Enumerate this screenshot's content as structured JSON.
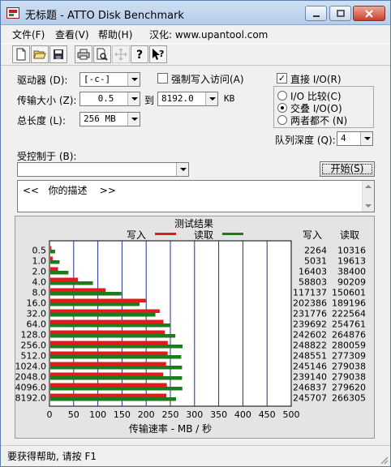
{
  "window": {
    "title": "无标题 - ATTO Disk Benchmark"
  },
  "menu": {
    "file": "文件(F)",
    "view": "查看(V)",
    "help": "帮助(H)",
    "credit": "汉化: www.upantool.com"
  },
  "toolbar": {
    "icons": [
      "new-file-icon",
      "open-folder-icon",
      "save-icon",
      "print-icon",
      "print-preview-icon",
      "move-icon",
      "help-icon",
      "context-help-icon"
    ]
  },
  "settings": {
    "drive_label": "驱动器 (D):",
    "drive_value": "[-c-]",
    "transfer_label": "传输大小 (Z):",
    "transfer_from": "0.5",
    "to_label": "到",
    "transfer_to": "8192.0",
    "kb_unit": "KB",
    "total_label": "总长度 (L):",
    "total_value": "256 MB",
    "force_write_label": "强制写入访问(A)",
    "force_write_checked": false,
    "direct_io_label": "直接 I/O(R)",
    "direct_io_checked": true,
    "io_compare_label": "I/O 比较(C)",
    "overlap_io_label": "交叠 I/O(O)",
    "neither_label": "两者都不 (N)",
    "selected_io_mode": "overlap",
    "queue_depth_label": "队列深度 (Q):",
    "queue_depth_value": "4",
    "controlled_by_label": "受控制于 (B):",
    "controlled_by_value": "",
    "start_button": "开始(S)",
    "description": "<<   你的描述    >>"
  },
  "chart_data": {
    "type": "bar",
    "title": "测试结果",
    "orientation": "horizontal",
    "legend": [
      {
        "name": "写入",
        "color": "#e01b1b"
      },
      {
        "name": "读取",
        "color": "#1d7a1d"
      }
    ],
    "legend_placement": "top",
    "categories": [
      "0.5",
      "1.0",
      "2.0",
      "4.0",
      "8.0",
      "16.0",
      "32.0",
      "64.0",
      "128.0",
      "256.0",
      "512.0",
      "1024.0",
      "2048.0",
      "4096.0",
      "8192.0"
    ],
    "series": [
      {
        "name": "写入",
        "color": "#e01b1b",
        "values": [
          2264,
          5031,
          16403,
          58803,
          117137,
          202386,
          231776,
          239692,
          242602,
          248822,
          248551,
          245146,
          239140,
          246837,
          245707
        ]
      },
      {
        "name": "读取",
        "color": "#1d7a1d",
        "values": [
          10316,
          19613,
          38400,
          90209,
          150601,
          189196,
          222564,
          254761,
          264876,
          280059,
          277309,
          279038,
          279038,
          279620,
          266305
        ]
      }
    ],
    "xlabel": "传输速率 - MB / 秒",
    "xlim": [
      0,
      500
    ],
    "x_ticks": [
      "0",
      "50",
      "100",
      "150",
      "200",
      "250",
      "300",
      "350",
      "400",
      "450",
      "500"
    ],
    "grid": true,
    "table_headers": [
      "写入",
      "读取"
    ],
    "value_unit": "KB/s"
  },
  "status": {
    "text": "要获得帮助, 请按 F1"
  }
}
